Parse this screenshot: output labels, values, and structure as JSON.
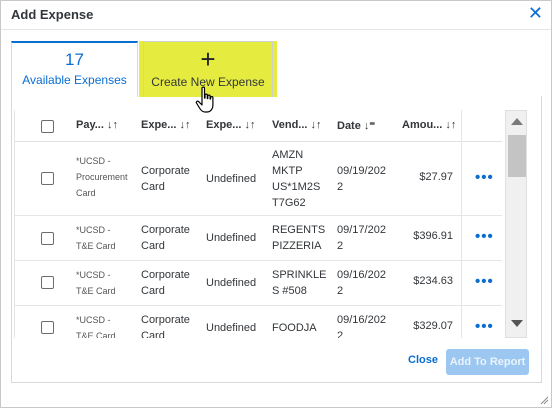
{
  "dialog": {
    "title": "Add Expense",
    "close_icon": "close-icon"
  },
  "tabs": {
    "available": {
      "count": "17",
      "label": "Available Expenses"
    },
    "create": {
      "icon": "plus-icon",
      "label": "Create New Expense"
    }
  },
  "table": {
    "columns": [
      {
        "label": "Pay...",
        "sort": "↓↑"
      },
      {
        "label": "Expe...",
        "sort": "↓↑"
      },
      {
        "label": "Expe...",
        "sort": "↓↑"
      },
      {
        "label": "Vend...",
        "sort": "↓↑"
      },
      {
        "label": "Date",
        "sort": "↓⁼"
      },
      {
        "label": "Amou...",
        "sort": "↓↑"
      }
    ],
    "rows": [
      {
        "payment": "*UCSD -\nProcurement\nCard",
        "expense_type": "Corporate\nCard",
        "expense_category": "Undefined",
        "vendor": "AMZN\nMKTP\nUS*1M2S\nT7G62",
        "date": "09/19/202\n2",
        "amount": "$27.97",
        "more": "•••"
      },
      {
        "payment": "*UCSD -\nT&E Card",
        "expense_type": "Corporate\nCard",
        "expense_category": "Undefined",
        "vendor": "REGENTS\nPIZZERIA",
        "date": "09/17/202\n2",
        "amount": "$396.91",
        "more": "•••"
      },
      {
        "payment": "*UCSD -\nT&E Card",
        "expense_type": "Corporate\nCard",
        "expense_category": "Undefined",
        "vendor": "SPRINKLE\nS #508",
        "date": "09/16/202\n2",
        "amount": "$234.63",
        "more": "•••"
      },
      {
        "payment": "*UCSD -\nT&E Card",
        "expense_type": "Corporate\nCard",
        "expense_category": "Undefined",
        "vendor": "FOODJA",
        "date": "09/16/202\n2",
        "amount": "$329.07",
        "more": "•••"
      }
    ]
  },
  "footer": {
    "close_label": "Close",
    "add_label": "Add To Report"
  },
  "colors": {
    "accent": "#0a6ed1",
    "highlight": "#e6ec3f",
    "disabled_button": "#9cc7f0"
  }
}
